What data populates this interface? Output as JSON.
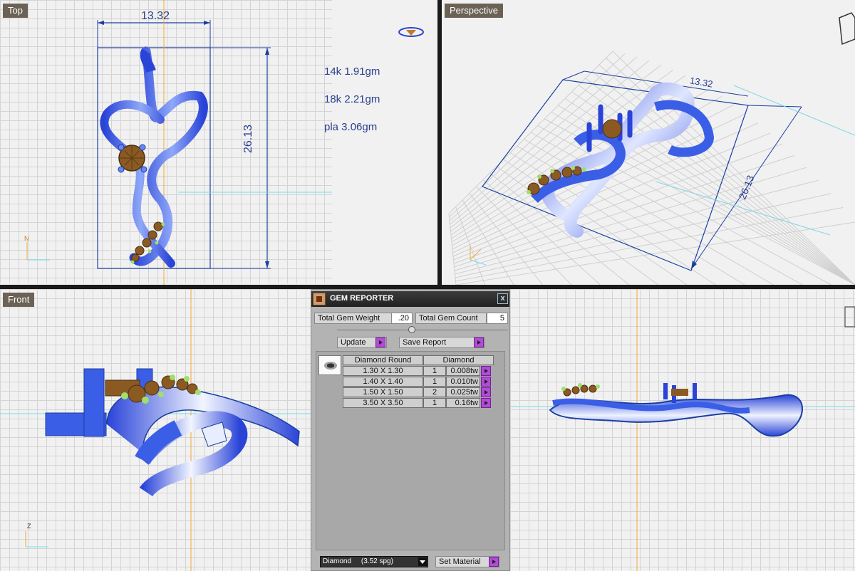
{
  "viewports": {
    "top": {
      "label": "Top"
    },
    "perspective": {
      "label": "Perspective"
    },
    "front": {
      "label": "Front"
    },
    "right": {
      "label": ""
    }
  },
  "dimensions": {
    "width": "13.32",
    "height": "26.13",
    "width_persp": "13.32",
    "height_persp": "26.13"
  },
  "weights": [
    "14k 1.91gm",
    "18k 2.21gm",
    "pla 3.06gm"
  ],
  "axis_labels": {
    "top_y": "N",
    "front_z": "Z"
  },
  "gem_reporter": {
    "title": "GEM REPORTER",
    "close": "x",
    "total_weight_label": "Total Gem Weight",
    "total_weight_value": ".20",
    "total_count_label": "Total Gem Count",
    "total_count_value": "5",
    "update_label": "Update",
    "save_report_label": "Save Report",
    "table": {
      "col_shape": "Diamond Round",
      "col_material": "Diamond",
      "rows": [
        {
          "size": "1.30 X 1.30",
          "count": "1",
          "weight": "0.008tw"
        },
        {
          "size": "1.40 X 1.40",
          "count": "1",
          "weight": "0.010tw"
        },
        {
          "size": "1.50 X 1.50",
          "count": "2",
          "weight": "0.025tw"
        },
        {
          "size": "3.50 X 3.50",
          "count": "1",
          "weight": "0.16tw"
        }
      ]
    },
    "material_select": "Diamond     (3.52 spg)",
    "set_material_label": "Set Material"
  },
  "colors": {
    "metal": "#3a5fe6",
    "gem": "#8a5a22",
    "prong": "#9fe06a",
    "label_bg": "#6b6155"
  }
}
